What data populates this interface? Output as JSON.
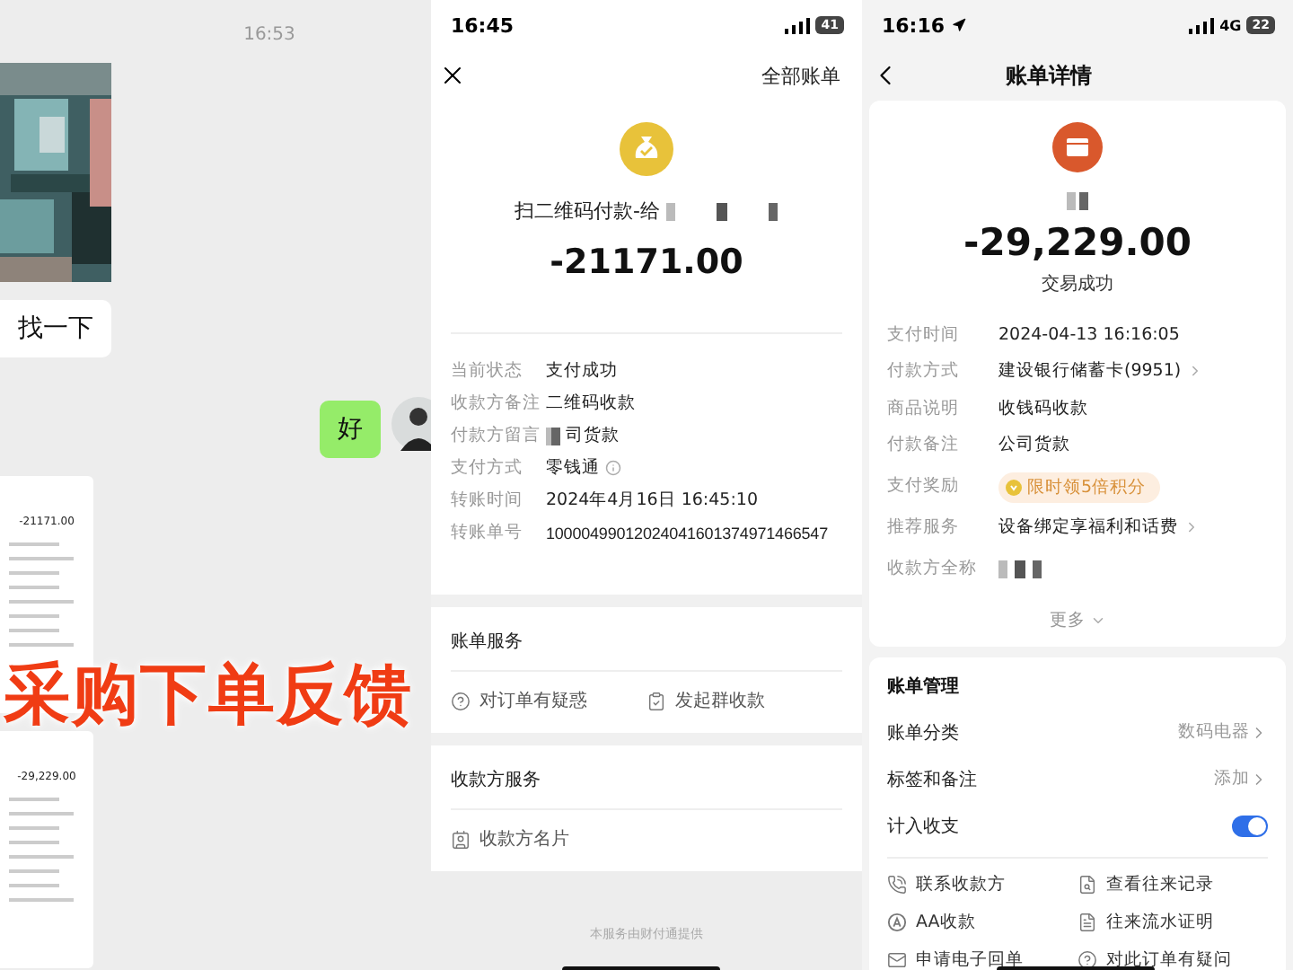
{
  "chat": {
    "time": "16:53",
    "messages": [
      {
        "kind": "picture"
      },
      {
        "kind": "incoming",
        "text": "找一下"
      },
      {
        "kind": "outgoing",
        "text": "好"
      },
      {
        "kind": "screenshot",
        "amount": "-21171.00"
      },
      {
        "kind": "screenshot",
        "amount": "-29,229.00"
      }
    ],
    "caption": "采购下单反馈"
  },
  "payment_detail": {
    "status_bar": {
      "time": "16:45",
      "battery": "41"
    },
    "all_bills": "全部账单",
    "title": "扫二维码付款-给",
    "amount": "-21171.00",
    "fields": [
      {
        "label": "当前状态",
        "value": "支付成功",
        "kind": "text"
      },
      {
        "label": "收款方备注",
        "value": "二维码收款",
        "kind": "text"
      },
      {
        "label": "付款方留言",
        "value": "司货款",
        "kind": "redacted"
      },
      {
        "label": "支付方式",
        "value": "零钱通",
        "kind": "info"
      },
      {
        "label": "转账时间",
        "value": "2024年4月16日 16:45:10",
        "kind": "text"
      },
      {
        "label": "转账单号",
        "value": "10000499012024041601374971466547",
        "kind": "text"
      }
    ],
    "sections": [
      {
        "title": "账单服务",
        "actions": [
          {
            "label": "对订单有疑惑"
          },
          {
            "label": "发起群收款"
          }
        ]
      },
      {
        "title": "收款方服务",
        "actions": [
          {
            "label": "收款方名片"
          }
        ]
      }
    ],
    "footer": "本服务由财付通提供"
  },
  "bill_detail": {
    "status_bar": {
      "time": "16:16",
      "network": "4G",
      "battery": "22"
    },
    "title": "账单详情",
    "amount": "-29,229.00",
    "result": "交易成功",
    "fields": [
      {
        "label": "支付时间",
        "value": "2024-04-13 16:16:05",
        "kind": "text"
      },
      {
        "label": "付款方式",
        "value": "建设银行储蓄卡(9951)",
        "kind": "link"
      },
      {
        "label": "商品说明",
        "value": "收钱码收款",
        "kind": "text"
      },
      {
        "label": "付款备注",
        "value": "公司货款",
        "kind": "text"
      },
      {
        "label": "支付奖励",
        "value": "限时领5倍积分",
        "kind": "badge"
      },
      {
        "label": "推荐服务",
        "value": "设备绑定享福利和话费",
        "kind": "link"
      },
      {
        "label": "收款方全称",
        "kind": "redacted"
      }
    ],
    "more": "更多",
    "management": {
      "title": "账单管理",
      "rows": [
        {
          "label": "账单分类",
          "value": "数码电器",
          "kind": "link"
        },
        {
          "label": "标签和备注",
          "value": "添加",
          "kind": "link"
        },
        {
          "label": "计入收支",
          "kind": "toggle",
          "on": true
        }
      ],
      "actions": [
        {
          "label": "联系收款方"
        },
        {
          "label": "查看往来记录"
        },
        {
          "label": "AA收款"
        },
        {
          "label": "往来流水证明"
        },
        {
          "label": "申请电子回单"
        },
        {
          "label": "对此订单有疑问"
        }
      ]
    }
  }
}
